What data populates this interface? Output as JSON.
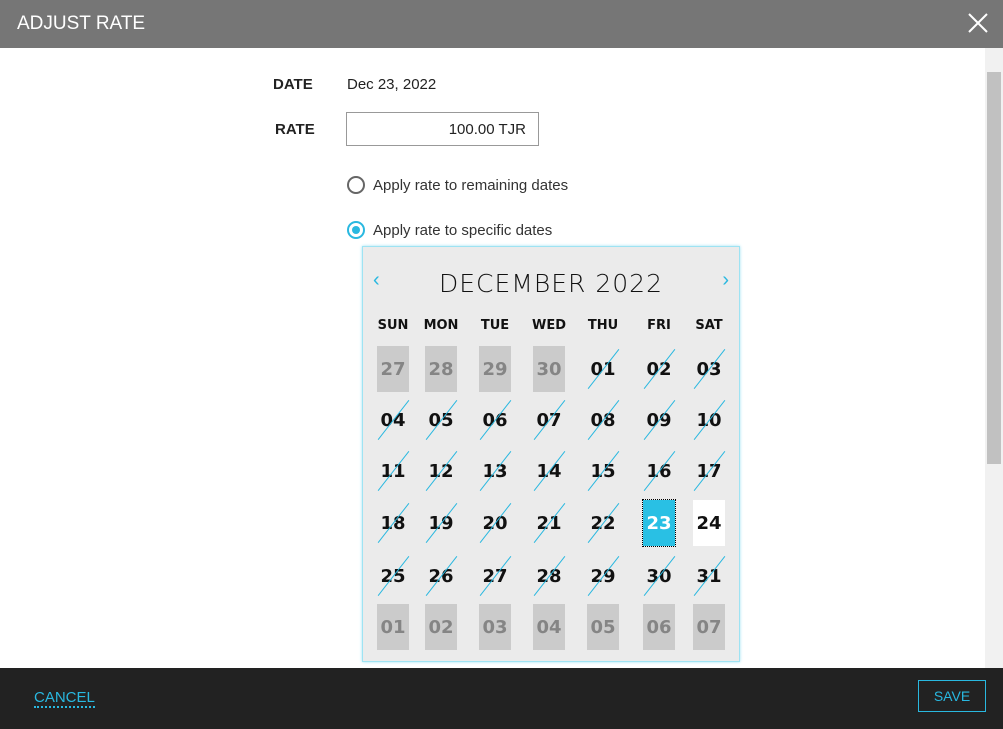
{
  "header": {
    "title": "ADJUST RATE"
  },
  "form": {
    "date_label": "DATE",
    "date_value": "Dec 23, 2022",
    "rate_label": "RATE",
    "rate_value": "100.00 TJR",
    "radio_remaining": "Apply rate to remaining dates",
    "radio_specific": "Apply rate to specific dates",
    "selected_option": "specific"
  },
  "calendar": {
    "month_title": "DECEMBER 2022",
    "prev": "‹",
    "next": "›",
    "weekdays": [
      "SUN",
      "MON",
      "TUE",
      "WED",
      "THU",
      "FRI",
      "SAT"
    ],
    "weeks": [
      [
        [
          "27",
          "other"
        ],
        [
          "28",
          "other"
        ],
        [
          "29",
          "other"
        ],
        [
          "30",
          "other"
        ],
        [
          "01",
          "past"
        ],
        [
          "02",
          "past"
        ],
        [
          "03",
          "past"
        ]
      ],
      [
        [
          "04",
          "past"
        ],
        [
          "05",
          "past"
        ],
        [
          "06",
          "past"
        ],
        [
          "07",
          "past"
        ],
        [
          "08",
          "past"
        ],
        [
          "09",
          "past"
        ],
        [
          "10",
          "past"
        ]
      ],
      [
        [
          "11",
          "past"
        ],
        [
          "12",
          "past"
        ],
        [
          "13",
          "past"
        ],
        [
          "14",
          "past"
        ],
        [
          "15",
          "past"
        ],
        [
          "16",
          "past"
        ],
        [
          "17",
          "past"
        ]
      ],
      [
        [
          "18",
          "past"
        ],
        [
          "19",
          "past"
        ],
        [
          "20",
          "past"
        ],
        [
          "21",
          "past"
        ],
        [
          "22",
          "past"
        ],
        [
          "23",
          "sel"
        ],
        [
          "24",
          "avail"
        ]
      ],
      [
        [
          "25",
          "past"
        ],
        [
          "26",
          "past"
        ],
        [
          "27",
          "past"
        ],
        [
          "28",
          "past"
        ],
        [
          "29",
          "past"
        ],
        [
          "30",
          "past"
        ],
        [
          "31",
          "past"
        ]
      ],
      [
        [
          "01",
          "other"
        ],
        [
          "02",
          "other"
        ],
        [
          "03",
          "other"
        ],
        [
          "04",
          "other"
        ],
        [
          "05",
          "other"
        ],
        [
          "06",
          "other"
        ],
        [
          "07",
          "other"
        ]
      ]
    ]
  },
  "footer": {
    "cancel": "CANCEL",
    "save": "SAVE"
  },
  "colors": {
    "accent": "#29b8e0",
    "header": "#767676",
    "footer": "#222222"
  }
}
